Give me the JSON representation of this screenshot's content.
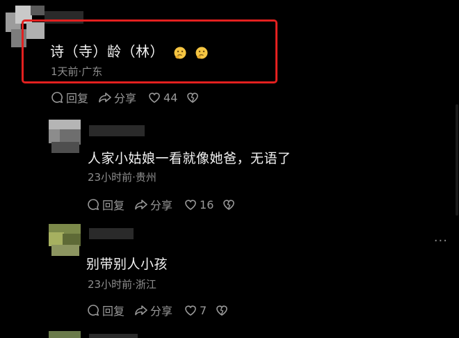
{
  "comments": [
    {
      "text": "诗（寺）龄（林）",
      "meta": "1天前·广东",
      "reply_label": "回复",
      "share_label": "分享",
      "likes": "44",
      "emoji": [
        "thinking-face-icon",
        "thinking-face-icon"
      ]
    },
    {
      "text": "人家小姑娘一看就像她爸，无语了",
      "meta": "23小时前·贵州",
      "reply_label": "回复",
      "share_label": "分享",
      "likes": "16"
    },
    {
      "text": "别带别人小孩",
      "meta": "23小时前·浙江",
      "reply_label": "回复",
      "share_label": "分享",
      "likes": "7"
    }
  ],
  "more_label": "···",
  "colors": {
    "highlight_box": "#e3201f",
    "meta": "#8e8e8e",
    "action": "#9a9a9a",
    "bg": "#000000"
  }
}
